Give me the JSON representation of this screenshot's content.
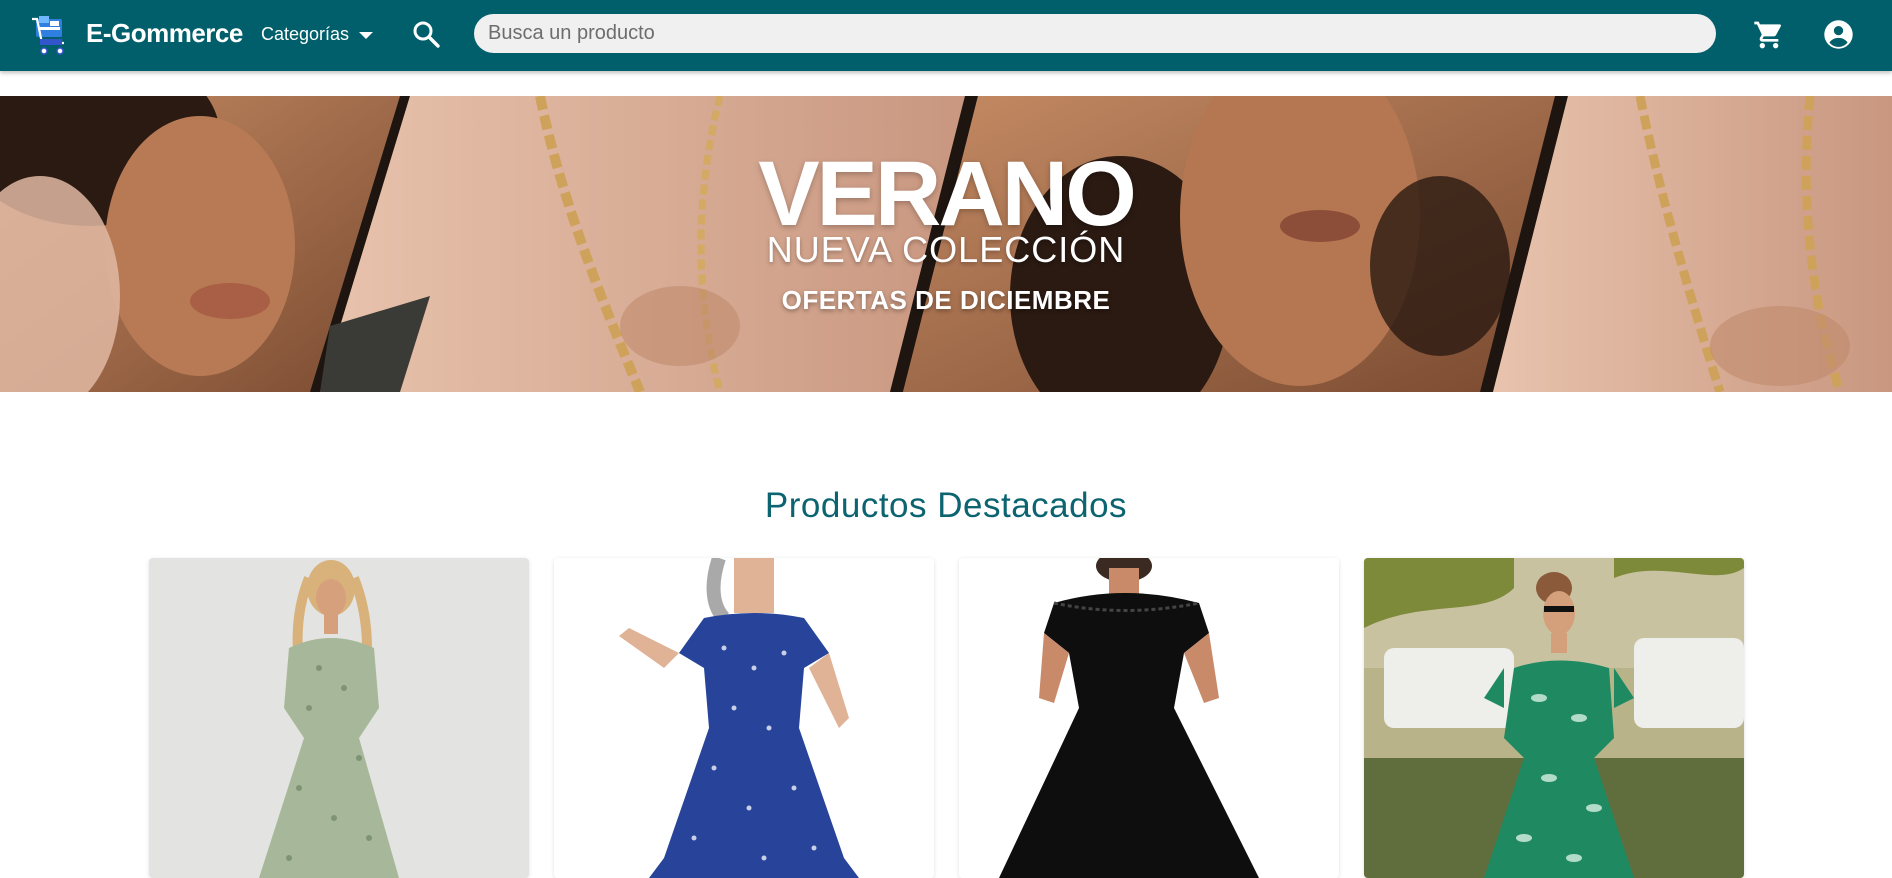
{
  "header": {
    "brand": "E-Gommerce",
    "categories_label": "Categorías",
    "search_placeholder": "Busca un producto",
    "icons": {
      "logo": "shopping-cart-logo-icon",
      "categories": "caret-down-icon",
      "search": "search-icon",
      "cart": "cart-icon",
      "account": "account-circle-icon"
    }
  },
  "hero": {
    "title": "VERANO",
    "subtitle": "NUEVA COLECCIÓN",
    "offer": "OFERTAS DE DICIEMBRE"
  },
  "featured": {
    "title": "Productos Destacados",
    "products": [
      {
        "image": "green floral dress on model",
        "dress_color": "#a7b89a"
      },
      {
        "image": "blue floral dress on model",
        "dress_color": "#27449a"
      },
      {
        "image": "black lace dress on model",
        "dress_color": "#0e0e0e"
      },
      {
        "image": "green tropical dress on model",
        "dress_color": "#1f8a62"
      }
    ]
  },
  "colors": {
    "header_bg": "#005f6a",
    "accent_text": "#0b6470"
  }
}
